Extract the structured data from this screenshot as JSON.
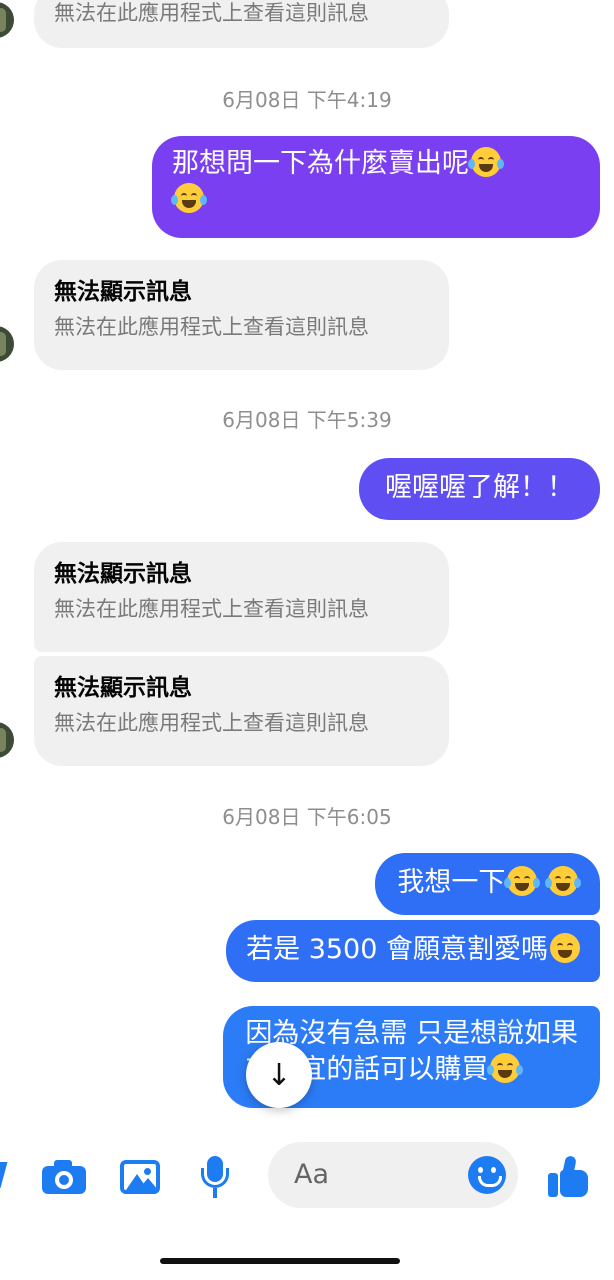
{
  "messages": {
    "m0": {
      "sub": "無法在此應用程式上查看這則訊息"
    },
    "ts1": "6月08日 下午4:19",
    "m1": {
      "text": "那想問一下為什麼賣出呢"
    },
    "m2": {
      "title": "無法顯示訊息",
      "sub": "無法在此應用程式上查看這則訊息"
    },
    "ts2": "6月08日 下午5:39",
    "m3": {
      "text": "喔喔喔了解！！"
    },
    "m4": {
      "title": "無法顯示訊息",
      "sub": "無法在此應用程式上查看這則訊息"
    },
    "m5": {
      "title": "無法顯示訊息",
      "sub": "無法在此應用程式上查看這則訊息"
    },
    "ts3": "6月08日 下午6:05",
    "m6": {
      "text": "我想一下"
    },
    "m7": {
      "text": "若是 3500 會願意割愛嗎"
    },
    "m8": {
      "line1": "因為沒有急需 只是想說如果",
      "line2": "有便宜的話可以購買"
    }
  },
  "composer": {
    "placeholder": "Aa"
  },
  "scroll_button": "↓",
  "icons": [
    "camera-icon",
    "gallery-icon",
    "microphone-icon",
    "emoji-icon",
    "thumbs-up-icon",
    "arrow-down-icon"
  ],
  "colors": {
    "purple_bubble": "#7b3ff2",
    "violet_bubble": "#5f4ff3",
    "blue_bubble": "#2f6ff6",
    "accent": "#1e7cf2",
    "incoming_bubble": "#f0f0f0"
  }
}
